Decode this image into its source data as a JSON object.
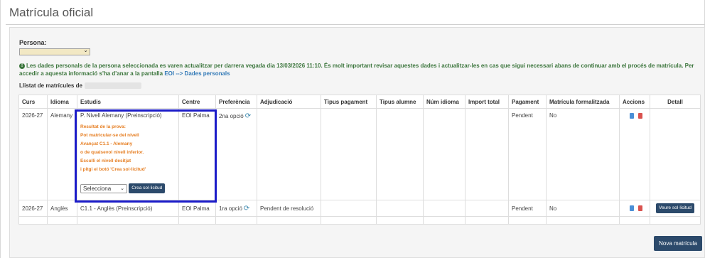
{
  "page": {
    "title": "Matrícula oficial"
  },
  "persona": {
    "label": "Persona:"
  },
  "notice": {
    "text": "Les dades personals de la persona seleccionada es varen actualitzar per darrera vegada dia 13/03/2026 11:10. És molt important revisar aquestes dades i actualitzar-les en cas que sigui necessari abans de continuar amb el procés de matrícula. Per accedir a aquesta informació s'ha d'anar a la pantalla ",
    "link": "EOI --> Dades personals"
  },
  "listing": {
    "label": "Llistat de matrícules de"
  },
  "table": {
    "headers": [
      "Curs",
      "Idioma",
      "Estudis",
      "Centre",
      "Preferència",
      "Adjudicació",
      "Tipus pagament",
      "Tipus alumne",
      "Núm idioma",
      "Import total",
      "Pagament",
      "Matrícula formalitzada",
      "Accions",
      "Detall"
    ],
    "rows": [
      {
        "curs": "2026-27",
        "idioma": "Alemany",
        "estudis": "P. Nivell Alemany (Preinscripció)",
        "warning": [
          "Resultat de la prova:",
          "Pot matricular-se del nivell",
          "Avançat C1.1 - Alemany",
          "o de qualsevol nivell inferior.",
          "Esculli el nivell desitjat",
          "i pitgi el botó 'Crea sol·licitud'"
        ],
        "select_value": "Selecciona",
        "create_button": "Crea sol·licitud",
        "centre": "EOI Palma",
        "preferencia": "2na opció",
        "adjudicacio": "",
        "pagament": "Pendent",
        "formalitzada": "No"
      },
      {
        "curs": "2026-27",
        "idioma": "Anglès",
        "estudis": "C1.1 - Anglès (Preinscripció)",
        "centre": "EOI Palma",
        "preferencia": "1ra opció",
        "adjudicacio": "Pendent de resolució",
        "pagament": "Pendent",
        "formalitzada": "No",
        "detail_button": "Veure sol·licitud"
      }
    ]
  },
  "buttons": {
    "new": "Nova matrícula"
  },
  "icons": {
    "info": "info-circle-icon",
    "refresh": "refresh-icon",
    "document": "document-icon",
    "delete": "trash-icon",
    "chevron": "chevron-down-icon"
  },
  "colors": {
    "success_text": "#3c763d",
    "warning_text": "#e67e22",
    "button": "#2c4a6b",
    "highlight": "#1b1bc8",
    "link": "#337ab7"
  }
}
